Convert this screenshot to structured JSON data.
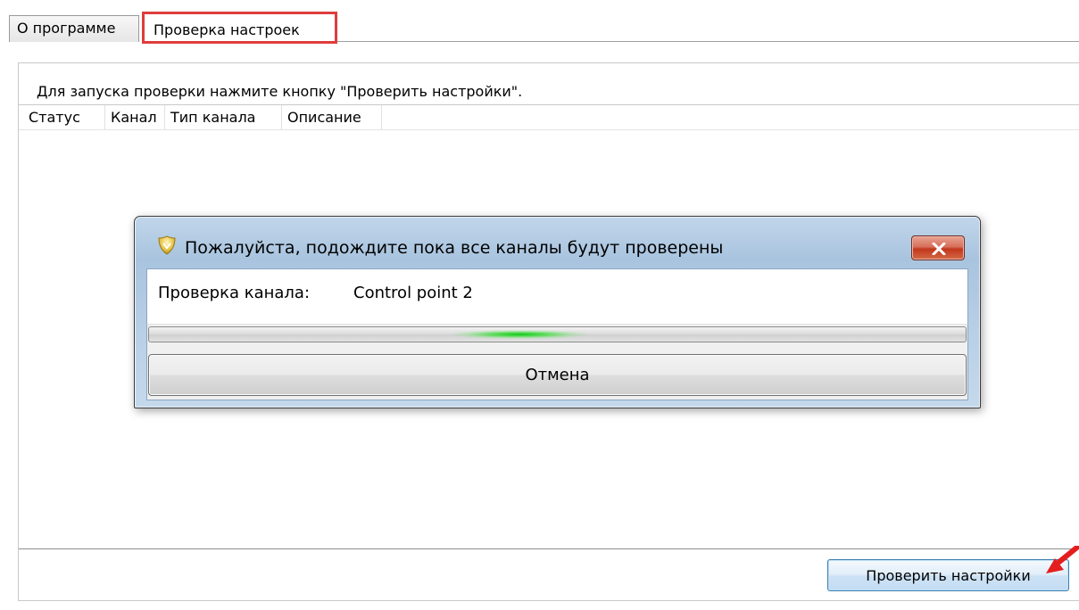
{
  "tabs": [
    {
      "label": "О программе",
      "selected": false
    },
    {
      "label": "Проверка настроек",
      "selected": true
    }
  ],
  "panel": {
    "hint": "Для запуска проверки нажмите кнопку \"Проверить настройки\".",
    "columns": [
      "Статус",
      "Канал",
      "Тип канала",
      "Описание"
    ],
    "check_button": "Проверить настройки"
  },
  "dialog": {
    "title": "Пожалуйста, подождите пока все каналы будут проверены",
    "channel_label": "Проверка канала:",
    "channel_value": "Control point 2",
    "progress_state": "indeterminate",
    "cancel_label": "Отмена"
  },
  "colors": {
    "highlight_border": "#e03c3c",
    "progress_glow": "#11c61b",
    "close_button": "#c2371c"
  }
}
